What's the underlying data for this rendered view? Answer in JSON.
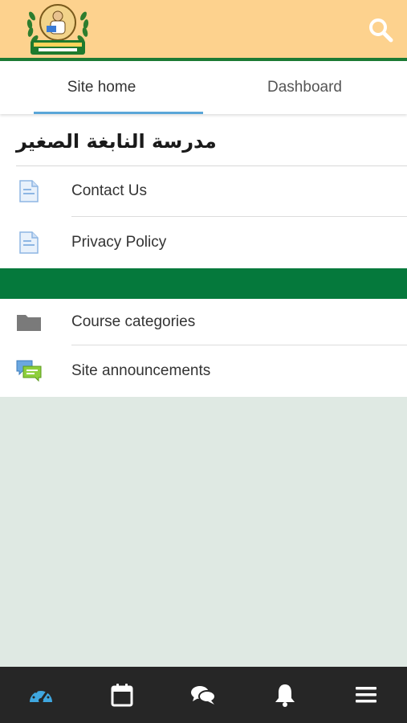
{
  "header": {
    "school_name_ar": "مدرسة النابغة الصغير",
    "logo_icon": "school-logo-icon",
    "search_icon": "search-icon",
    "colors": {
      "header_bg": "#fdd28e",
      "border": "#1c7a34"
    }
  },
  "tabs": [
    {
      "label": "Site home",
      "active": true
    },
    {
      "label": "Dashboard",
      "active": false
    }
  ],
  "main": {
    "section_title": "مدرسة النابغة الصغير",
    "pages": [
      {
        "label": "Contact Us",
        "icon": "page-icon"
      },
      {
        "label": "Privacy Policy",
        "icon": "page-icon"
      }
    ],
    "items": [
      {
        "label": "Course categories",
        "icon": "folder-icon"
      },
      {
        "label": "Site announcements",
        "icon": "forum-icon"
      }
    ],
    "colors": {
      "band": "#05793c"
    }
  },
  "bottom_nav": {
    "items": [
      {
        "icon": "dashboard-icon",
        "active": true
      },
      {
        "icon": "calendar-icon",
        "active": false
      },
      {
        "icon": "messages-icon",
        "active": false
      },
      {
        "icon": "notifications-bell-icon",
        "active": false
      },
      {
        "icon": "menu-icon",
        "active": false
      }
    ],
    "colors": {
      "bg": "#262626",
      "active": "#3fa7e0",
      "inactive": "#ffffff"
    }
  }
}
